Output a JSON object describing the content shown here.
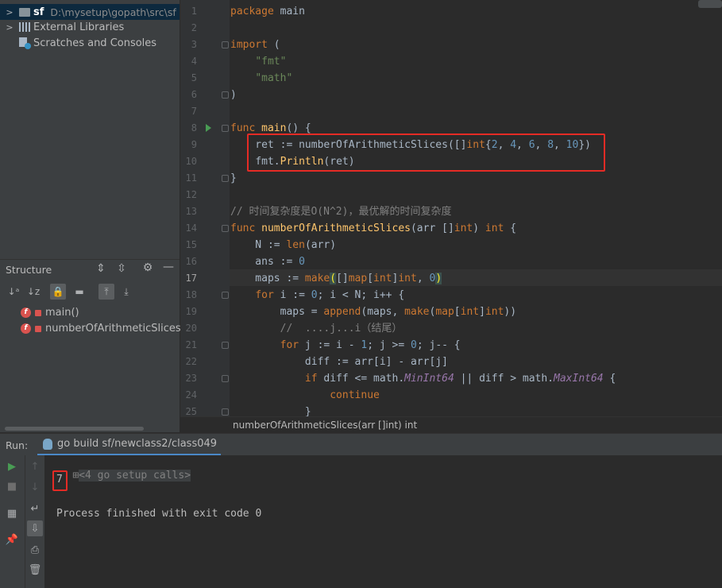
{
  "project": {
    "root_name": "sf",
    "root_path": "D:\\mysetup\\gopath\\src\\sf",
    "external_libraries": "External Libraries",
    "scratches": "Scratches and Consoles"
  },
  "structure": {
    "title": "Structure",
    "items": [
      {
        "badge": "f",
        "label": "main()"
      },
      {
        "badge": "f",
        "label": "numberOfArithmeticSlices(ar"
      }
    ]
  },
  "editor": {
    "line_numbers": [
      "1",
      "2",
      "3",
      "4",
      "5",
      "6",
      "7",
      "8",
      "9",
      "10",
      "11",
      "12",
      "13",
      "14",
      "15",
      "16",
      "17",
      "18",
      "19",
      "20",
      "21",
      "22",
      "23",
      "24",
      "25"
    ],
    "current_line": "17"
  },
  "breadcrumb": {
    "text": "numberOfArithmeticSlices(arr []int) int"
  },
  "run": {
    "label": "Run:",
    "tab_title": "go build sf/newclass2/class049",
    "console_lines": {
      "setup_calls": "<4 go setup calls>",
      "output": "7",
      "finished": "Process finished with exit code 0"
    }
  },
  "colors": {
    "keyword": "#cc7832",
    "string": "#6a8759",
    "number": "#6897bb",
    "function": "#ffc66d",
    "comment": "#808080",
    "highlight_box": "#e52b25"
  }
}
